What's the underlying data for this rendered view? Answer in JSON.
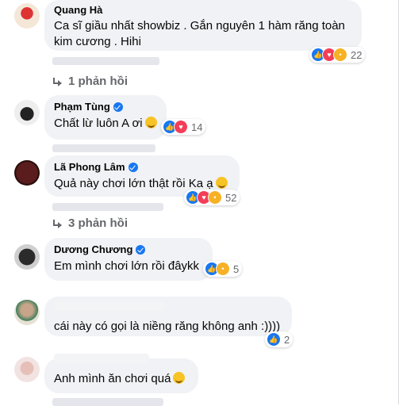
{
  "comments": [
    {
      "name": "Quang Hà",
      "text": "Ca sĩ giầu nhất showbiz . Gắn nguyên 1 hàm răng toàn kim cương . Hihi",
      "reaction_count": "22"
    },
    {
      "name": "Phạm Tùng",
      "text": "Chất lừ luôn A ơi",
      "reaction_count": "14"
    },
    {
      "name": "Lã Phong Lâm",
      "text": "Quả này chơi lớn thật rồi Ka ạ",
      "reaction_count": "52"
    },
    {
      "name": "Dương Chương",
      "text": "Em mình chơi lớn rồi đâykk",
      "reaction_count": "5"
    },
    {
      "name": "",
      "text": "cái này có gọi là niềng răng không anh :))))",
      "reaction_count": "2"
    },
    {
      "name": "",
      "text": "Anh mình ăn chơi quá",
      "reaction_count": ""
    }
  ],
  "replies": [
    {
      "label": "1 phản hồi"
    },
    {
      "label": "3 phản hồi"
    }
  ]
}
